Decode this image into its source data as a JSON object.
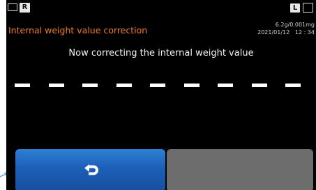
{
  "header": {
    "status_left": "R",
    "status_right": "L",
    "title": "Internal weight value correction",
    "capacity": "6.2g/0.001mg",
    "datetime": "2021/01/12   12 : 34"
  },
  "main": {
    "message": "Now correcting the internal weight value",
    "placeholder_dash_count": 9
  },
  "buttons": {
    "back_icon": "return-arrow-icon",
    "right_button_label": ""
  },
  "colors": {
    "background": "#000000",
    "title": "#f07a2a",
    "back_button": "#1c5fb7",
    "disabled_button": "#6d6d6d"
  }
}
